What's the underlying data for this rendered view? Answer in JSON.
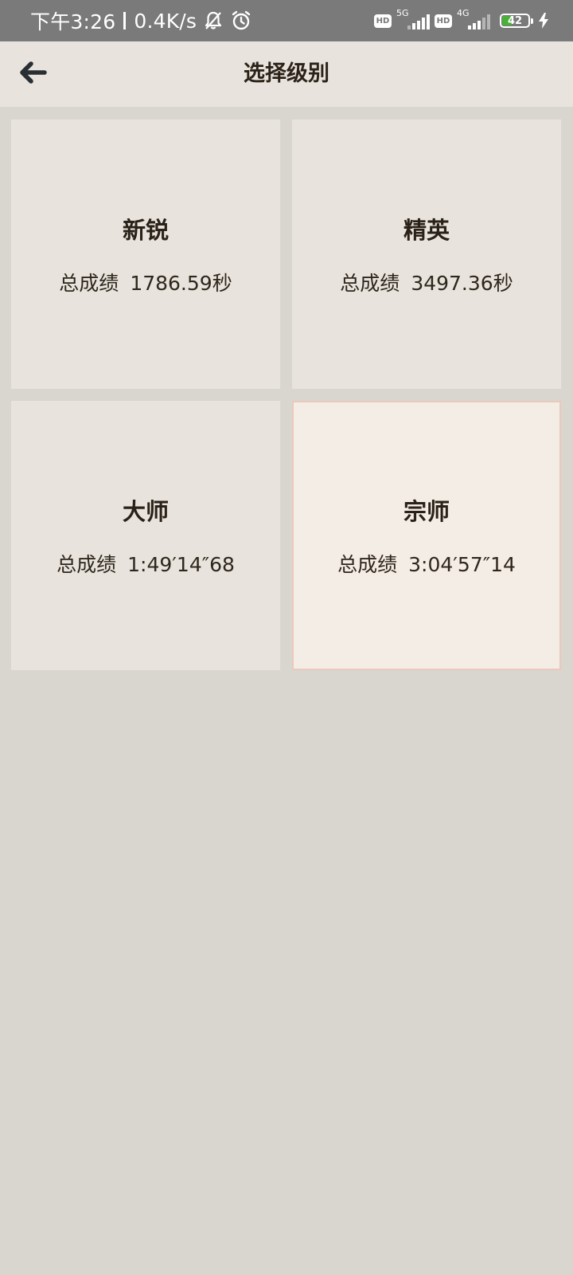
{
  "status_bar": {
    "time": "下午3:26",
    "net_speed": "0.4K/s",
    "icons": [
      "bell-off-icon",
      "alarm-icon"
    ],
    "sim1": {
      "hd": "HD",
      "network": "5G"
    },
    "sim2": {
      "hd": "HD",
      "network": "4G"
    },
    "battery_level": "42",
    "battery_color": "#4caf3a",
    "charging": true
  },
  "header": {
    "back_icon": "arrow-left-icon",
    "title": "选择级别"
  },
  "levels": [
    {
      "name": "新锐",
      "score_label": "总成绩",
      "score_value": "1786.59秒",
      "selected": false
    },
    {
      "name": "精英",
      "score_label": "总成绩",
      "score_value": "3497.36秒",
      "selected": false
    },
    {
      "name": "大师",
      "score_label": "总成绩",
      "score_value": "1:49′14″68",
      "selected": false
    },
    {
      "name": "宗师",
      "score_label": "总成绩",
      "score_value": "3:04′57″14",
      "selected": true
    }
  ],
  "colors": {
    "status_bar_bg": "#7a7a7a",
    "app_bar_bg": "#e8e4dd",
    "page_bg": "#d9d6d0",
    "card_bg": "#e8e4dd",
    "selected_card_bg": "#f4ede5",
    "selected_card_border": "#ebc8bc"
  }
}
